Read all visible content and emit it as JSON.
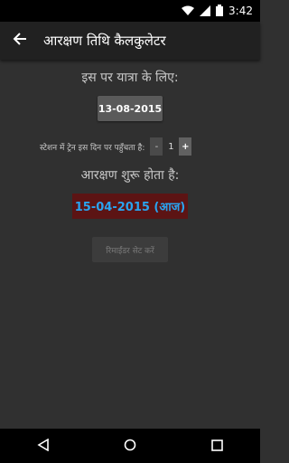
{
  "status_bar": {
    "time": "3:42"
  },
  "toolbar": {
    "title": "आरक्षण तिथि कैलकुलेटर"
  },
  "main": {
    "travel_label": "इस पर यात्रा के लिए:",
    "travel_date": "13-08-2015",
    "days_label": "स्टेशन में ट्रेन इस दिन पर पहुँचता है:",
    "stepper": {
      "minus": "-",
      "value": "1",
      "plus": "+"
    },
    "opens_label": "आरक्षण शुरू होता है:",
    "result_date": "15-04-2015 (आज)",
    "reminder_button": "रिमाईंडर सेट करें"
  },
  "colors": {
    "background": "#303030",
    "toolbar": "#212121",
    "result_bg": "#5c1414",
    "result_text": "#29a4f0"
  },
  "icons": [
    "wifi-icon",
    "signal-icon",
    "battery-icon",
    "back-arrow-icon",
    "nav-back-icon",
    "nav-home-icon",
    "nav-recents-icon"
  ]
}
